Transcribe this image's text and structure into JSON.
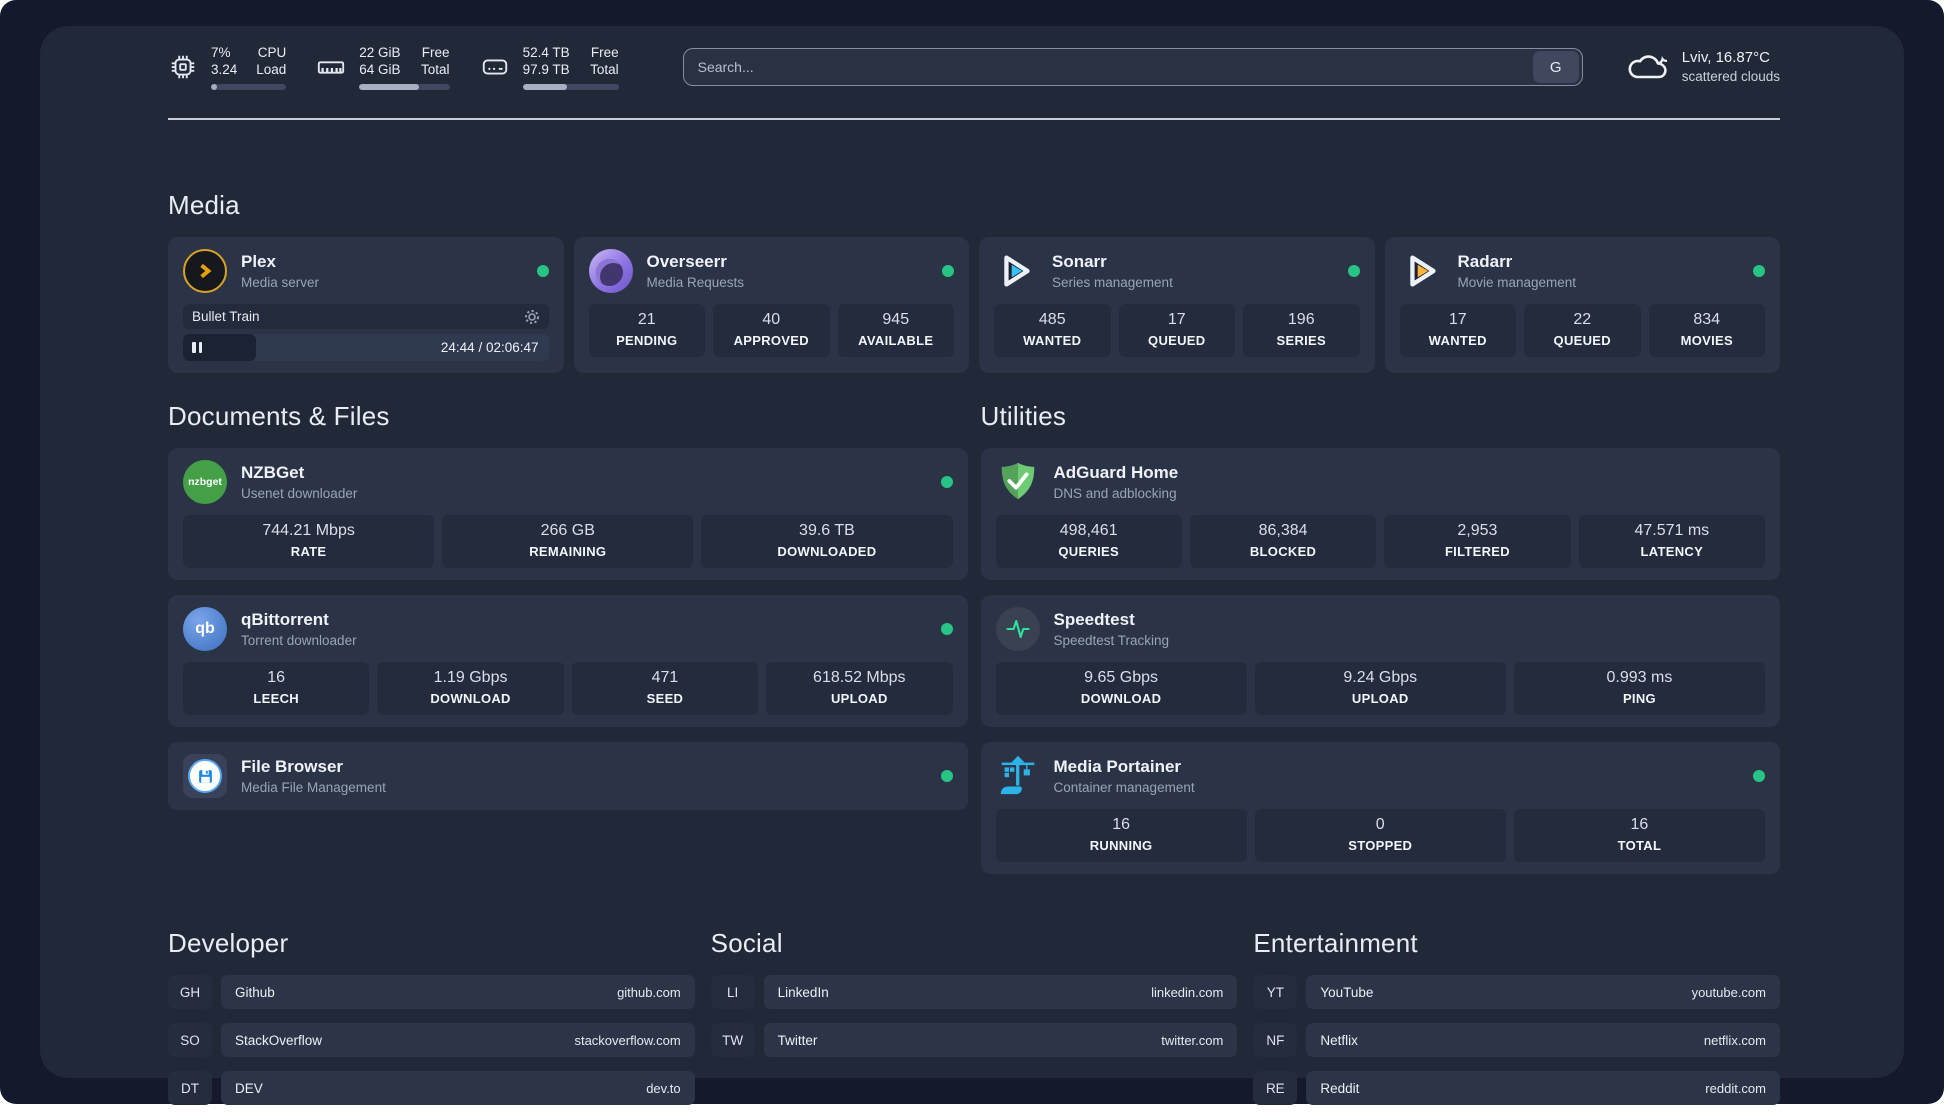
{
  "topbar": {
    "cpu": {
      "usage": "7%",
      "load": "3.24",
      "label_top": "CPU",
      "label_bottom": "Load",
      "progress_pct": 8
    },
    "memory": {
      "free": "22 GiB",
      "total": "64 GiB",
      "label_top": "Free",
      "label_bottom": "Total",
      "progress_pct": 66
    },
    "disk": {
      "free": "52.4 TB",
      "total": "97.9 TB",
      "label_top": "Free",
      "label_bottom": "Total",
      "progress_pct": 46
    },
    "search": {
      "placeholder": "Search...",
      "engine_button": "G"
    },
    "weather": {
      "location": "Lviv, 16.87°C",
      "condition": "scattered clouds"
    }
  },
  "media": {
    "title": "Media",
    "plex": {
      "name": "Plex",
      "description": "Media server",
      "status": "online",
      "player": {
        "title": "Bullet Train",
        "time": "24:44 / 02:06:47",
        "progress_pct": 20
      }
    },
    "overseerr": {
      "name": "Overseerr",
      "description": "Media Requests",
      "status": "online",
      "stats": [
        {
          "value": "21",
          "label": "PENDING"
        },
        {
          "value": "40",
          "label": "APPROVED"
        },
        {
          "value": "945",
          "label": "AVAILABLE"
        }
      ]
    },
    "sonarr": {
      "name": "Sonarr",
      "description": "Series management",
      "status": "online",
      "stats": [
        {
          "value": "485",
          "label": "WANTED"
        },
        {
          "value": "17",
          "label": "QUEUED"
        },
        {
          "value": "196",
          "label": "SERIES"
        }
      ]
    },
    "radarr": {
      "name": "Radarr",
      "description": "Movie management",
      "status": "online",
      "stats": [
        {
          "value": "17",
          "label": "WANTED"
        },
        {
          "value": "22",
          "label": "QUEUED"
        },
        {
          "value": "834",
          "label": "MOVIES"
        }
      ]
    }
  },
  "documents": {
    "title": "Documents & Files",
    "nzbget": {
      "name": "NZBGet",
      "description": "Usenet downloader",
      "status": "online",
      "stats": [
        {
          "value": "744.21 Mbps",
          "label": "RATE"
        },
        {
          "value": "266 GB",
          "label": "REMAINING"
        },
        {
          "value": "39.6 TB",
          "label": "DOWNLOADED"
        }
      ]
    },
    "qbittorrent": {
      "name": "qBittorrent",
      "description": "Torrent downloader",
      "status": "online",
      "stats": [
        {
          "value": "16",
          "label": "LEECH"
        },
        {
          "value": "1.19 Gbps",
          "label": "DOWNLOAD"
        },
        {
          "value": "471",
          "label": "SEED"
        },
        {
          "value": "618.52 Mbps",
          "label": "UPLOAD"
        }
      ]
    },
    "filebrowser": {
      "name": "File Browser",
      "description": "Media File Management",
      "status": "online"
    }
  },
  "utilities": {
    "title": "Utilities",
    "adguard": {
      "name": "AdGuard Home",
      "description": "DNS and adblocking",
      "stats": [
        {
          "value": "498,461",
          "label": "QUERIES"
        },
        {
          "value": "86,384",
          "label": "BLOCKED"
        },
        {
          "value": "2,953",
          "label": "FILTERED"
        },
        {
          "value": "47.571 ms",
          "label": "LATENCY"
        }
      ]
    },
    "speedtest": {
      "name": "Speedtest",
      "description": "Speedtest Tracking",
      "stats": [
        {
          "value": "9.65 Gbps",
          "label": "DOWNLOAD"
        },
        {
          "value": "9.24 Gbps",
          "label": "UPLOAD"
        },
        {
          "value": "0.993 ms",
          "label": "PING"
        }
      ]
    },
    "portainer": {
      "name": "Media Portainer",
      "description": "Container management",
      "status": "online",
      "stats": [
        {
          "value": "16",
          "label": "RUNNING"
        },
        {
          "value": "0",
          "label": "STOPPED"
        },
        {
          "value": "16",
          "label": "TOTAL"
        }
      ]
    }
  },
  "bookmarks": {
    "developer": {
      "title": "Developer",
      "links": [
        {
          "abbr": "GH",
          "name": "Github",
          "url": "github.com"
        },
        {
          "abbr": "SO",
          "name": "StackOverflow",
          "url": "stackoverflow.com"
        },
        {
          "abbr": "DT",
          "name": "DEV",
          "url": "dev.to"
        }
      ]
    },
    "social": {
      "title": "Social",
      "links": [
        {
          "abbr": "LI",
          "name": "LinkedIn",
          "url": "linkedin.com"
        },
        {
          "abbr": "TW",
          "name": "Twitter",
          "url": "twitter.com"
        }
      ]
    },
    "entertainment": {
      "title": "Entertainment",
      "links": [
        {
          "abbr": "YT",
          "name": "YouTube",
          "url": "youtube.com"
        },
        {
          "abbr": "NF",
          "name": "Netflix",
          "url": "netflix.com"
        },
        {
          "abbr": "RE",
          "name": "Reddit",
          "url": "reddit.com"
        }
      ]
    }
  },
  "colors": {
    "status_online": "#27c485",
    "plex_accent": "#e5a00d",
    "sonarr_accent": "#36c3f2",
    "radarr_accent": "#ffb53a",
    "adguard_accent": "#63bd68",
    "portainer_accent": "#2cb3e8"
  }
}
